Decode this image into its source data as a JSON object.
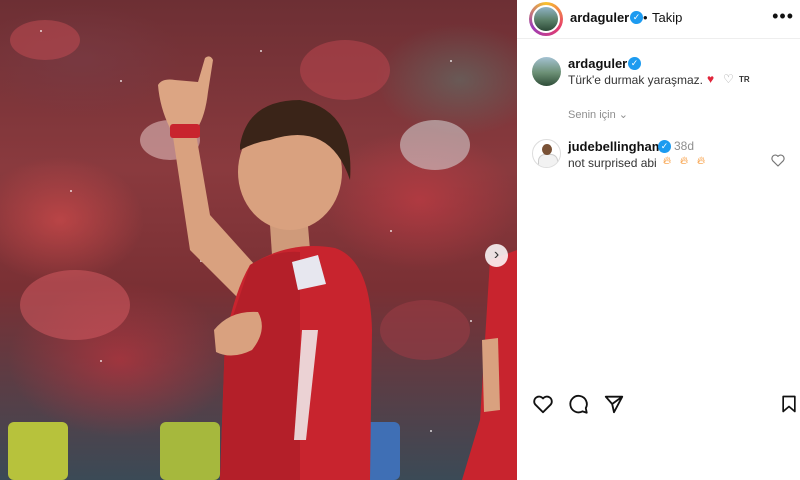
{
  "post": {
    "author": "ardaguler",
    "follow_label": "Takip",
    "more_icon": "more-dots-icon",
    "next_icon": "chevron-right-icon"
  },
  "caption": {
    "username": "ardaguler",
    "text": "Türk'e durmak yaraşmaz.",
    "lang_tag": "TR"
  },
  "filter": {
    "label": "Senin için",
    "icon": "chevron-down-icon"
  },
  "comment": {
    "username": "judebellingham",
    "age": "38d",
    "text": "not surprised abi"
  },
  "actions": [
    "heart-icon",
    "comment-icon",
    "share-icon",
    "bookmark-icon"
  ],
  "colors": {
    "verified": "#1d9bf0",
    "heart": "#e0263b",
    "jersey": "#c8242e"
  }
}
